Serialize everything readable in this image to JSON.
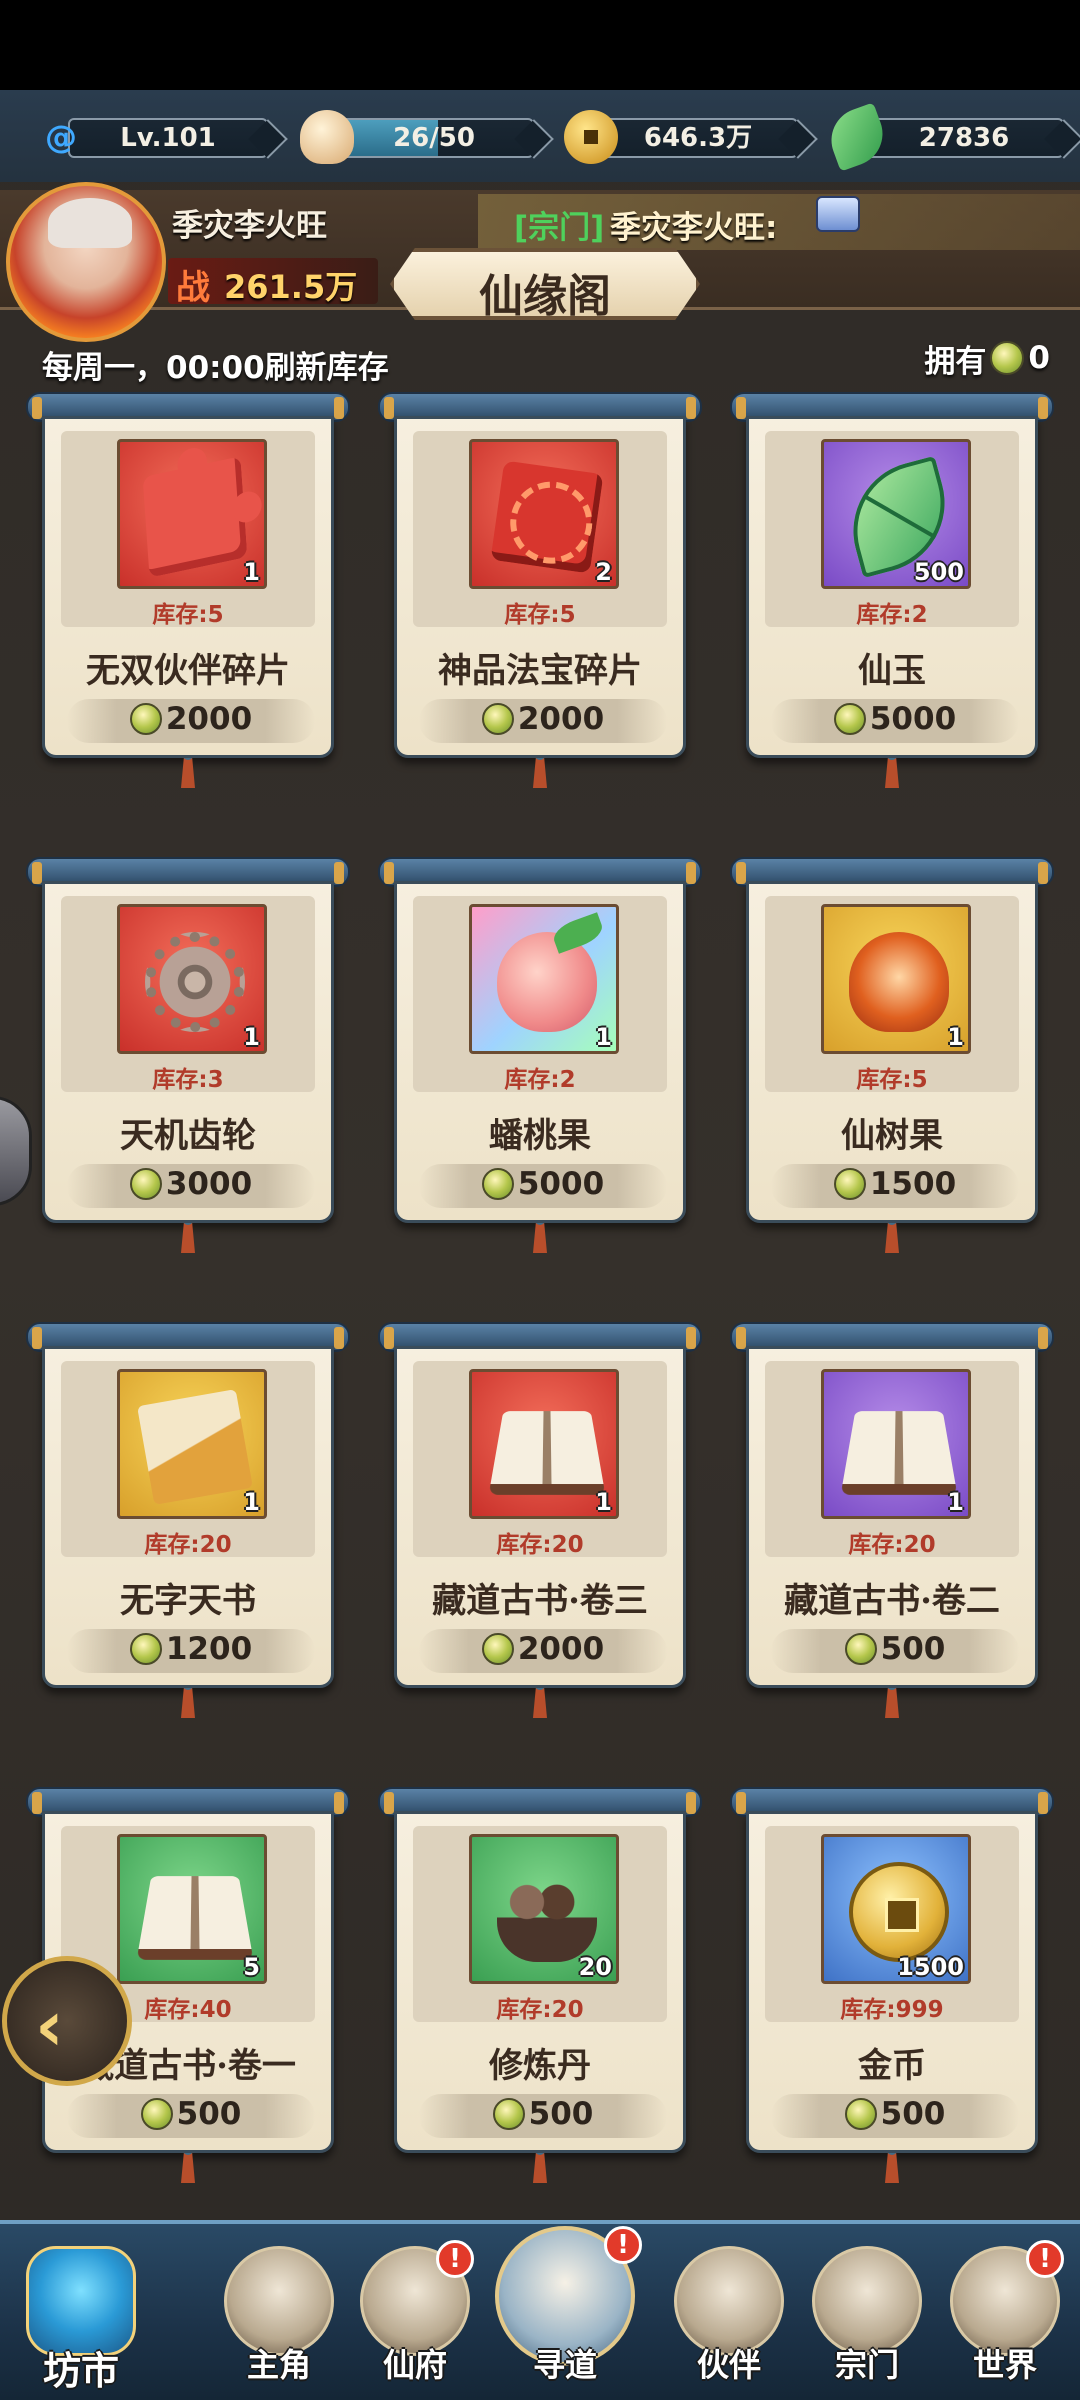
{
  "resources": {
    "level": "Lv.101",
    "stamina": "26/50",
    "stamina_fraction": 0.52,
    "gold": "646.3万",
    "jade": "27836"
  },
  "player": {
    "name": "季灾李火旺",
    "power_label": "战",
    "power": "261.5万"
  },
  "chat": {
    "channel": "[宗门]",
    "message": "季灾李火旺:"
  },
  "shop": {
    "title": "仙缘阁",
    "refresh_note": "每周一，00:00刷新库存",
    "owned_label": "拥有",
    "owned_count": "0"
  },
  "items": [
    {
      "name": "无双伙伴碎片",
      "qty": "1",
      "stock": "库存:5",
      "price": "2000",
      "icon": "puzzle-piece-icon",
      "bg": "red"
    },
    {
      "name": "神品法宝碎片",
      "qty": "2",
      "stock": "库存:5",
      "price": "2000",
      "icon": "puzzle-fragment-icon",
      "bg": "red"
    },
    {
      "name": "仙玉",
      "qty": "500",
      "stock": "库存:2",
      "price": "5000",
      "icon": "jade-leaf-icon",
      "bg": "purple"
    },
    {
      "name": "天机齿轮",
      "qty": "1",
      "stock": "库存:3",
      "price": "3000",
      "icon": "gear-icon",
      "bg": "red"
    },
    {
      "name": "蟠桃果",
      "qty": "1",
      "stock": "库存:2",
      "price": "5000",
      "icon": "peach-icon",
      "bg": "rainbow"
    },
    {
      "name": "仙树果",
      "qty": "1",
      "stock": "库存:5",
      "price": "1500",
      "icon": "fruit-icon",
      "bg": "gold"
    },
    {
      "name": "无字天书",
      "qty": "1",
      "stock": "库存:20",
      "price": "1200",
      "icon": "scroll-icon",
      "bg": "gold"
    },
    {
      "name": "藏道古书·卷三",
      "qty": "1",
      "stock": "库存:20",
      "price": "2000",
      "icon": "book-icon",
      "bg": "red"
    },
    {
      "name": "藏道古书·卷二",
      "qty": "1",
      "stock": "库存:20",
      "price": "500",
      "icon": "book-icon",
      "bg": "purple"
    },
    {
      "name": "藏道古书·卷一",
      "qty": "5",
      "stock": "库存:40",
      "price": "500",
      "icon": "book-icon",
      "bg": "green"
    },
    {
      "name": "修炼丹",
      "qty": "20",
      "stock": "库存:20",
      "price": "500",
      "icon": "pill-bowl-icon",
      "bg": "green"
    },
    {
      "name": "金币",
      "qty": "1500",
      "stock": "库存:999",
      "price": "500",
      "icon": "gold-coin-icon",
      "bg": "blue"
    }
  ],
  "nav": {
    "market": "坊市",
    "hero": "主角",
    "mansion": "仙府",
    "quest": "寻道",
    "partner": "伙伴",
    "sect": "宗门",
    "world": "世界",
    "badge": "!"
  }
}
